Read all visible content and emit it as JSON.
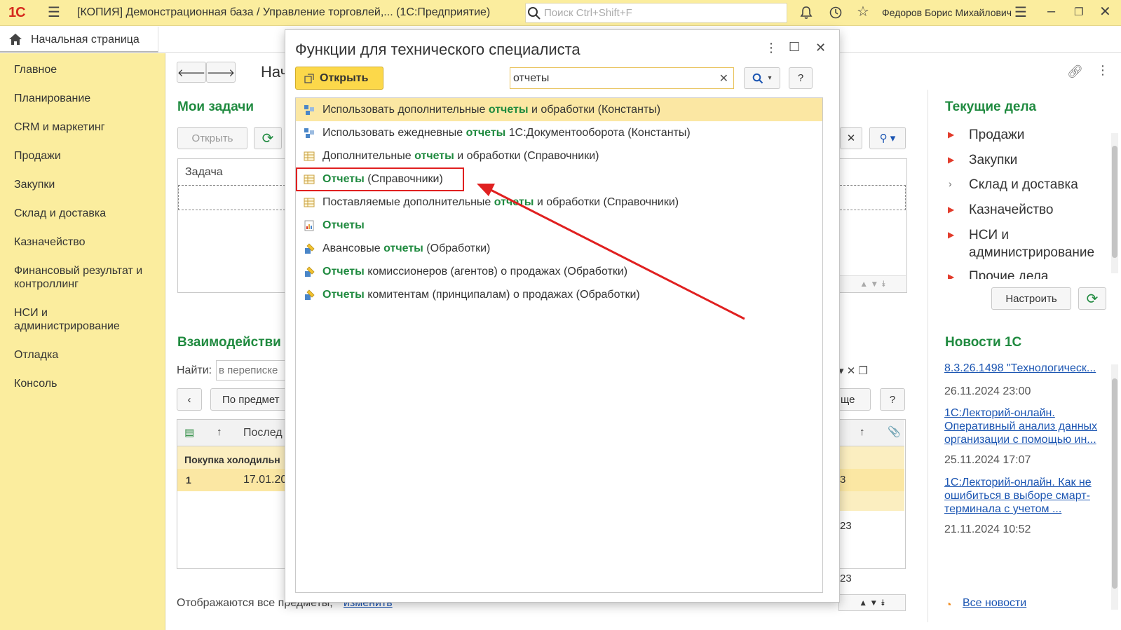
{
  "titlebar": {
    "logo": "1С",
    "app_title": "[КОПИЯ] Демонстрационная база / Управление торговлей,...   (1С:Предприятие)",
    "search_placeholder": "Поиск Ctrl+Shift+F",
    "user_name": "Федоров Борис Михайлович"
  },
  "home_tab": {
    "label": "Начальная страница"
  },
  "sidebar": {
    "items": [
      {
        "label": "Главное"
      },
      {
        "label": "Планирование"
      },
      {
        "label": "CRM и маркетинг"
      },
      {
        "label": "Продажи"
      },
      {
        "label": "Закупки"
      },
      {
        "label": "Склад и доставка"
      },
      {
        "label": "Казначейство"
      },
      {
        "label": "Финансовый результат и контроллинг"
      },
      {
        "label": "НСИ и администрирование"
      },
      {
        "label": "Отладка"
      },
      {
        "label": "Консоль"
      }
    ]
  },
  "main": {
    "page_title_partial": "Нач",
    "tasks": {
      "title": "Мои задачи",
      "open_label": "Открыть",
      "column_task": "Задача"
    },
    "interactions": {
      "title": "Взаимодействи",
      "find_label": "Найти:",
      "find_placeholder": "в переписке",
      "subject_btn": "По предмет",
      "more_btn": "ще",
      "help": "?",
      "column_last": "Послед",
      "group_row": "Покупка холодильн",
      "row_num": "1",
      "row_date": "17.01.20",
      "right_cells": [
        "3",
        "23",
        "23"
      ]
    },
    "footer_text": "Отображаются все предметы,",
    "footer_link": "изменить"
  },
  "right_panel": {
    "current_title": "Текущие дела",
    "current_items": [
      {
        "label": "Продажи",
        "marker": "red-triangle"
      },
      {
        "label": "Закупки",
        "marker": "red-triangle"
      },
      {
        "label": "Склад и доставка",
        "marker": "chevron"
      },
      {
        "label": "Казначейство",
        "marker": "red-triangle"
      },
      {
        "label": "НСИ и администрирование",
        "marker": "red-triangle"
      },
      {
        "label": "Прочие дела",
        "marker": "red-triangle"
      }
    ],
    "configure_label": "Настроить",
    "news_title": "Новости 1С",
    "news": [
      {
        "title": "8.3.26.1498 \"Технологическ...",
        "date": "26.11.2024 23:00"
      },
      {
        "title": "1С:Лекторий-онлайн. Оперативный анализ данных организации с помощью ин...",
        "date": "25.11.2024 17:07"
      },
      {
        "title": "1С:Лекторий-онлайн. Как не ошибиться в выборе смарт-терминала с учетом ...",
        "date": "21.11.2024 10:52"
      }
    ],
    "all_news": "Все новости"
  },
  "dialog": {
    "title": "Функции для технического специалиста",
    "open_label": "Открыть",
    "filter_value": "отчеты",
    "help": "?",
    "results": [
      {
        "pre": "Использовать дополнительные ",
        "hl": "отчеты",
        "post": " и обработки (Константы)",
        "icon": "constant-icon",
        "selected": true
      },
      {
        "pre": "Использовать ежедневные ",
        "hl": "отчеты",
        "post": " 1С:Документооборота (Константы)",
        "icon": "constant-icon",
        "selected": false
      },
      {
        "pre": "Дополнительные ",
        "hl": "отчеты",
        "post": " и обработки (Справочники)",
        "icon": "catalog-icon",
        "selected": false
      },
      {
        "pre": "",
        "hl": "Отчеты",
        "post": " (Справочники)",
        "icon": "catalog-icon",
        "selected": false
      },
      {
        "pre": "Поставляемые дополнительные ",
        "hl": "отчеты",
        "post": " и обработки (Справочники)",
        "icon": "catalog-icon",
        "selected": false
      },
      {
        "pre": "",
        "hl": "Отчеты",
        "post": "",
        "icon": "report-icon",
        "selected": false
      },
      {
        "pre": "Авансовые ",
        "hl": "отчеты",
        "post": " (Обработки)",
        "icon": "processing-icon",
        "selected": false
      },
      {
        "pre": "",
        "hl": "Отчеты",
        "post": " комиссионеров (агентов) о продажах (Обработки)",
        "icon": "processing-icon",
        "selected": false
      },
      {
        "pre": "",
        "hl": "Отчеты",
        "post": " комитентам (принципалам) о продажах (Обработки)",
        "icon": "processing-icon",
        "selected": false
      }
    ]
  },
  "colors": {
    "sidebar_bg": "#fbed9e",
    "accent_green": "#1f8a3f",
    "open_button": "#fcd84a",
    "selected_row": "#fbe7a3",
    "annotation_red": "#e02020"
  }
}
